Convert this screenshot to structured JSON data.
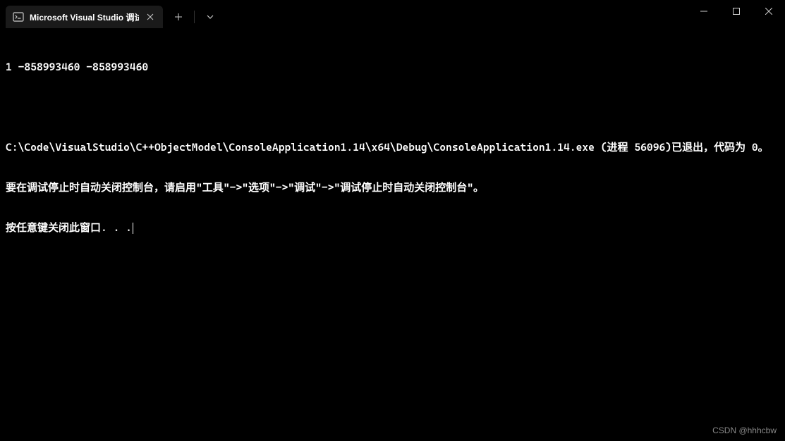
{
  "window": {
    "tab": {
      "title": "Microsoft Visual Studio 调试"
    }
  },
  "console": {
    "line1": "1 -858993460 -858993460",
    "line2": "",
    "line3": "C:\\Code\\VisualStudio\\C++ObjectModel\\ConsoleApplication1.14\\x64\\Debug\\ConsoleApplication1.14.exe (进程 56096)已退出，代码为 0。",
    "line4": "要在调试停止时自动关闭控制台，请启用\"工具\"->\"选项\"->\"调试\"->\"调试停止时自动关闭控制台\"。",
    "line5": "按任意键关闭此窗口. . ."
  },
  "watermark": "CSDN @hhhcbw"
}
